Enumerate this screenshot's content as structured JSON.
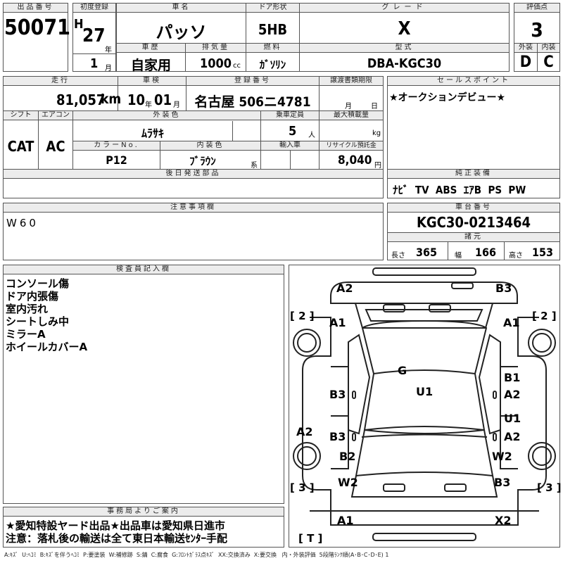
{
  "header": {
    "lot_label": "出品番号",
    "lot_no": "50071",
    "first_reg_label": "初度登録",
    "era": "H",
    "year": "27",
    "year_unit": "年",
    "month": "1",
    "month_unit": "月",
    "car_name_label": "車名",
    "car_name": "パッソ",
    "door_label": "ドア形状",
    "door": "5HB",
    "grade_label": "グレード",
    "grade": "X",
    "score_label": "評価点",
    "score": "3",
    "history_label": "車歴",
    "history": "自家用",
    "displacement_label": "排気量",
    "displacement": "1000",
    "displacement_unit": "cc",
    "fuel_label": "燃料",
    "fuel": "ｶﾞｿﾘﾝ",
    "model_label": "型式",
    "model": "DBA-KGC30",
    "ext_label": "外装",
    "ext": "D",
    "int_label": "内装",
    "int": "C"
  },
  "row2": {
    "mileage_label": "走行",
    "mileage": "81,057",
    "mileage_unit": "km",
    "inspection_label": "車検",
    "insp_year": "10",
    "insp_year_unit": "年",
    "insp_month": "01",
    "insp_month_unit": "月",
    "reg_label": "登録番号",
    "reg": "名古屋 506ニ4781",
    "transfer_label": "譲渡書類期限",
    "transfer_m": "月",
    "transfer_d": "日",
    "shift_label": "シフト",
    "shift": "CAT",
    "ac_label": "エアコン",
    "ac": "AC",
    "color_label": "外装色",
    "color": "ﾑﾗｻｷ",
    "capacity_label": "乗車定員",
    "capacity": "5",
    "capacity_unit": "人",
    "load_label": "最大積載量",
    "load_unit": "kg",
    "colorno_label": "カラーNo.",
    "colorno": "P12",
    "intcolor_label": "内装色",
    "intcolor": "ﾌﾞﾗｳﾝ",
    "intcolor_unit": "系",
    "import_label": "輸入車",
    "recycle_label": "リサイクル預託金",
    "recycle": "8,040",
    "recycle_unit": "円",
    "later_label": "後日発送部品"
  },
  "sales": {
    "label": "セールスポイント",
    "text": "★オークションデビュー★"
  },
  "equipment": {
    "label": "純正装備",
    "text": "ﾅﾋﾞ  TV  ABS  ｴｱB  PS  PW"
  },
  "caution": {
    "label": "注意事項欄",
    "text": "W60"
  },
  "chassis": {
    "label": "車台番号",
    "value": "KGC30-0213464",
    "spec_label": "諸元",
    "len_label": "長さ",
    "len": "365",
    "wid_label": "幅",
    "wid": "166",
    "hgt_label": "高さ",
    "hgt": "153"
  },
  "inspector": {
    "label": "検査員記入欄",
    "lines": [
      "コンソール傷",
      "ドア内張傷",
      "室内汚れ",
      "シートしみ中",
      "ミラーA",
      "ホイールカバーA"
    ]
  },
  "office": {
    "label": "事務局よりご案内",
    "line1": "★愛知特設ヤード出品★出品車は愛知県日進市",
    "line2": "注意：落札後の輸送は全て東日本輸送ｾﾝﾀｰ手配"
  },
  "diagram": {
    "marks": [
      "A2",
      "B3",
      "A1",
      "A1",
      "G",
      "U1",
      "B1",
      "A2",
      "B3",
      "U1",
      "A2",
      "B3",
      "A2",
      "B2",
      "W2",
      "W2",
      "B3",
      "A1",
      "X2"
    ],
    "brackets": [
      "[ 2 ]",
      "[ 2 ]",
      "[ 3 ]",
      "[ 3 ]",
      "[ T ]"
    ]
  },
  "legend": "A:ｷｽﾞ  U:ﾍｺﾐ  B:ｷｽﾞを伴うﾍｺﾐ  P:要塗装  W:補修跡  S:錆  C:腐食  G:ﾌﾛﾝﾄｶﾞﾗｽ点ｷｽﾞ  XX:交換済み  X:要交換   内・外装評価  5段階ﾗﾝｸ順(A･B･C･D･E) 1"
}
